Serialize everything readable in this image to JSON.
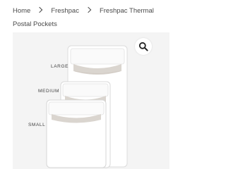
{
  "breadcrumb": {
    "home": "Home",
    "category": "Freshpac",
    "current": "Freshpac Thermal Postal Pockets"
  },
  "gallery": {
    "zoom_icon": "magnifier-icon",
    "labels": {
      "large": "LARGE",
      "medium": "MEDIUM",
      "small": "SMALL"
    }
  }
}
